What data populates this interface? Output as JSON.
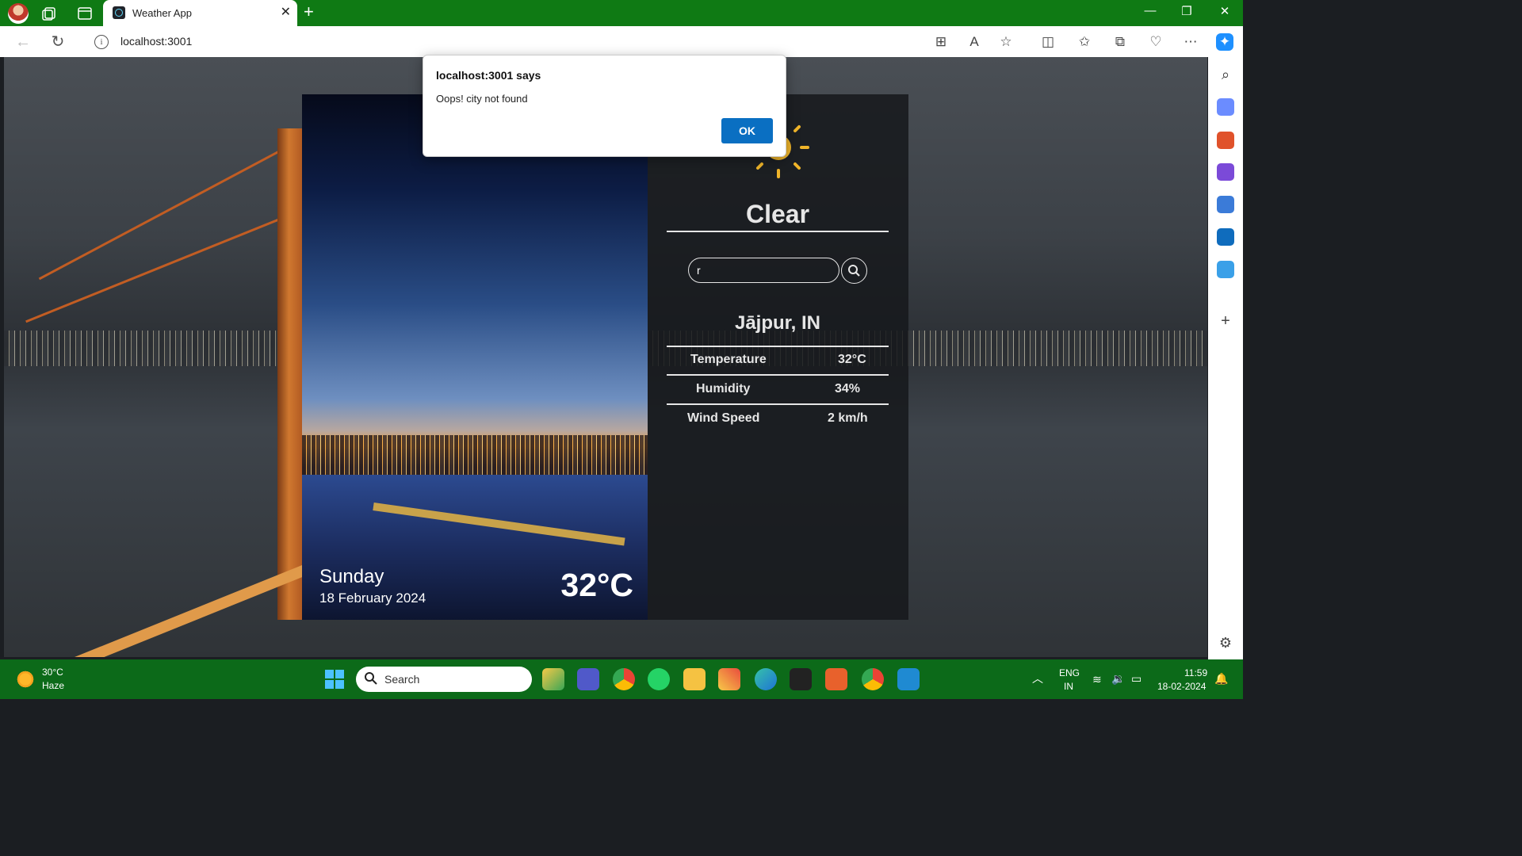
{
  "browser": {
    "tab_title": "Weather App",
    "tab_close": "✕",
    "new_tab": "+",
    "url": "localhost:3001",
    "window_controls": [
      "—",
      "❐",
      "✕"
    ]
  },
  "weather_card": {
    "day": "Sunday",
    "date": "18 February 2024",
    "temperature_big": "32°C",
    "condition": "Clear",
    "search_value": "r",
    "location": "Jājpur, IN",
    "stats": [
      {
        "label": "Temperature",
        "value": "32°C"
      },
      {
        "label": "Humidity",
        "value": "34%"
      },
      {
        "label": "Wind Speed",
        "value": "2 km/h"
      }
    ]
  },
  "alert": {
    "title": "localhost:3001 says",
    "message": "Oops! city not found",
    "ok_label": "OK"
  },
  "taskbar": {
    "weather_temp": "30°C",
    "weather_desc": "Haze",
    "search_label": "Search",
    "lang_top": "ENG",
    "lang_bottom": "IN",
    "time": "11:59",
    "date": "18-02-2024"
  },
  "colors": {
    "title_bar": "#0f7a14",
    "taskbar": "#0c6a19",
    "alert_ok": "#0a6fc2",
    "sun": "#f0b52a"
  }
}
